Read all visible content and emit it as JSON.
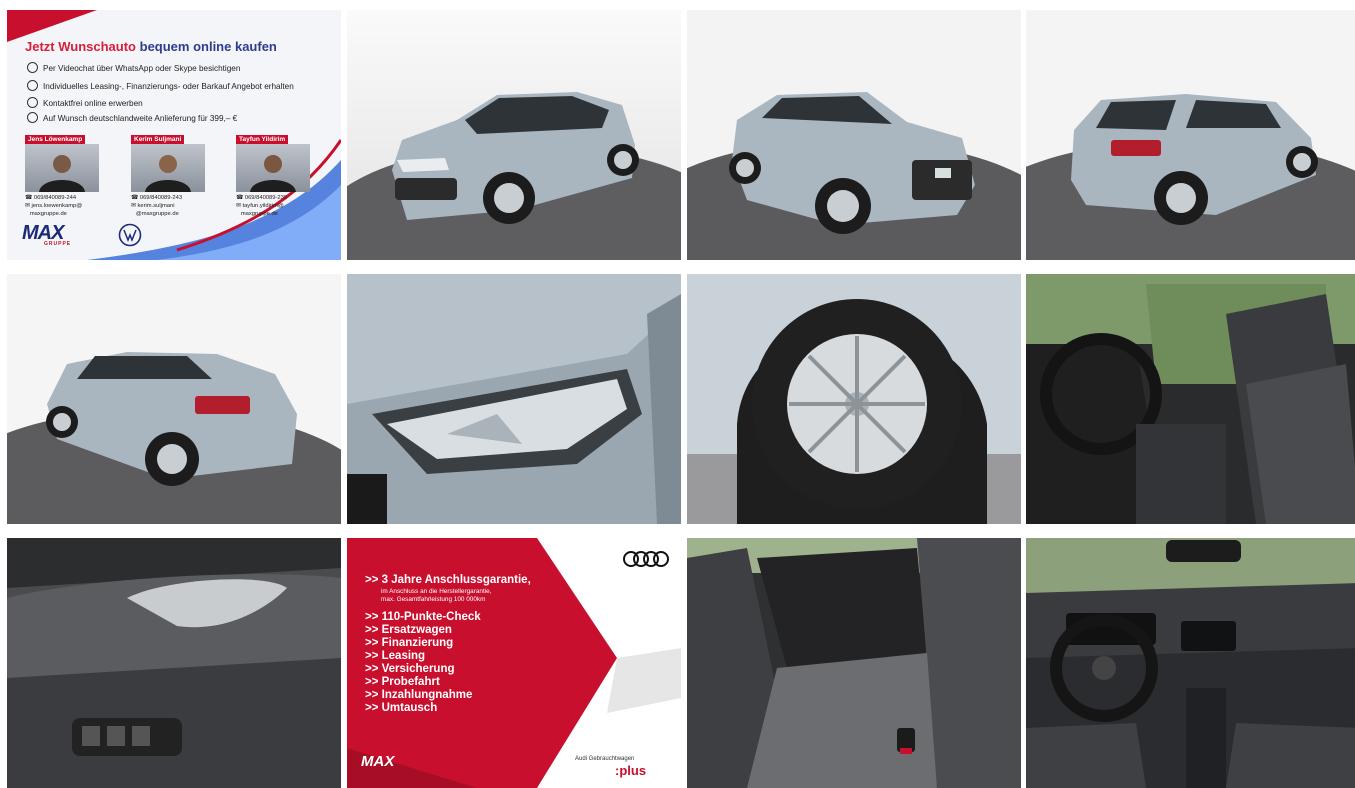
{
  "promo1": {
    "headline_red": "Jetzt Wunschauto",
    "headline_blue": "bequem online kaufen",
    "bullets": [
      "Per Videochat über WhatsApp oder Skype besichtigen",
      "Individuelles Leasing-, Finanzierungs- oder Barkauf Angebot erhalten",
      "Kontaktfrei online erwerben",
      "Auf Wunsch deutschlandweite Anlieferung für 399,– €"
    ],
    "contacts": [
      {
        "name": "Jens Löwenkamp",
        "phone": "069/840089-244",
        "email1": "jens.loewenkamp@",
        "email2": "maxgruppe.de"
      },
      {
        "name": "Kerim Suljmani",
        "phone": "069/840089-243",
        "email1": "kerim.suljmani",
        "email2": "@maxgruppe.de"
      },
      {
        "name": "Tayfun Yildirim",
        "phone": "069/840089-239",
        "email1": "tayfun.yildirim@",
        "email2": "maxgruppe.de"
      }
    ],
    "logo": "MAX",
    "logo_sub": "GRUPPE"
  },
  "promo2": {
    "headline": ">> 3 Jahre Anschlussgarantie,",
    "sub1": "im Anschluss an die Herstellergarantie,",
    "sub2": "max. Gesamtfahrleistung 100 000km",
    "items": [
      ">> 110-Punkte-Check",
      ">> Ersatzwagen",
      ">> Finanzierung",
      ">> Leasing",
      ">> Versicherung",
      ">> Probefahrt",
      ">> Inzahlungnahme",
      ">> Umtausch"
    ],
    "brand_small": "Audi Gebrauchtwagen",
    "brand_plus": ":plus",
    "logo": "MAX"
  },
  "colors": {
    "audi_red": "#c8102e",
    "car_paint": "#a9b5bf",
    "floor": "#5e5e60",
    "max_blue": "#1b2a7a"
  }
}
